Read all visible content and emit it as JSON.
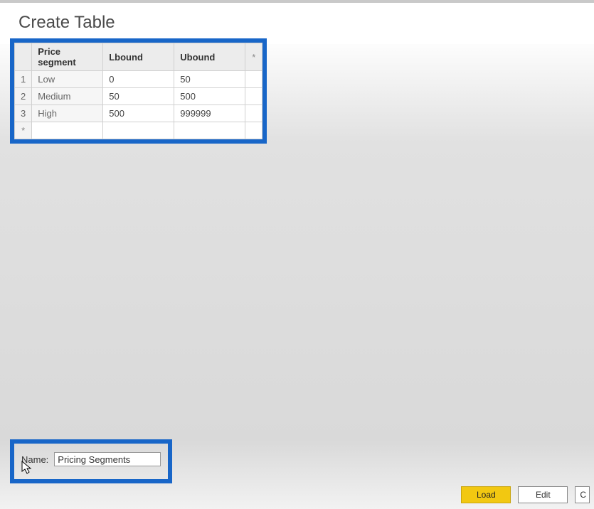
{
  "title": "Create Table",
  "columns": {
    "c0": "Price segment",
    "c1": "Lbound",
    "c2": "Ubound"
  },
  "addcol": "*",
  "addrow": "*",
  "rows": [
    {
      "n": "1",
      "seg": "Low",
      "lb": "0",
      "ub": "50"
    },
    {
      "n": "2",
      "seg": "Medium",
      "lb": "50",
      "ub": "500"
    },
    {
      "n": "3",
      "seg": "High",
      "lb": "500",
      "ub": "999999"
    }
  ],
  "name_label": "Name:",
  "name_value": "Pricing Segments",
  "buttons": {
    "load": "Load",
    "edit": "Edit",
    "cancel_initial": "C"
  }
}
